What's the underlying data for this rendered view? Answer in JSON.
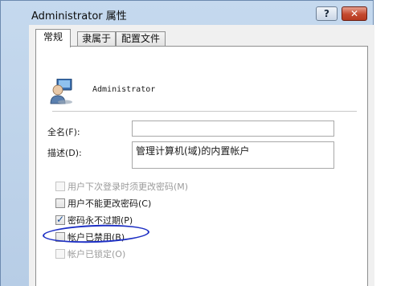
{
  "window": {
    "title": "Administrator 属性",
    "help_label": "?",
    "close_label": "✕"
  },
  "tabs": [
    {
      "label": "常规",
      "active": true
    },
    {
      "label": "隶属于",
      "active": false
    },
    {
      "label": "配置文件",
      "active": false
    }
  ],
  "user": {
    "name": "Administrator",
    "icon": "user-icon"
  },
  "fields": {
    "fullname_label": "全名(F):",
    "fullname_value": "",
    "description_label": "描述(D):",
    "description_value": "管理计算机(域)的内置帐户"
  },
  "checkboxes": [
    {
      "label": "用户下次登录时须更改密码(M)",
      "checked": false,
      "enabled": false
    },
    {
      "label": "用户不能更改密码(C)",
      "checked": false,
      "enabled": true
    },
    {
      "label": "密码永不过期(P)",
      "checked": true,
      "enabled": true
    },
    {
      "label": "帐户已禁用(B)",
      "checked": false,
      "enabled": true
    },
    {
      "label": "帐户已锁定(O)",
      "checked": false,
      "enabled": false
    }
  ],
  "colors": {
    "annotation": "#1d2fc4",
    "check": "#1b4d93"
  }
}
